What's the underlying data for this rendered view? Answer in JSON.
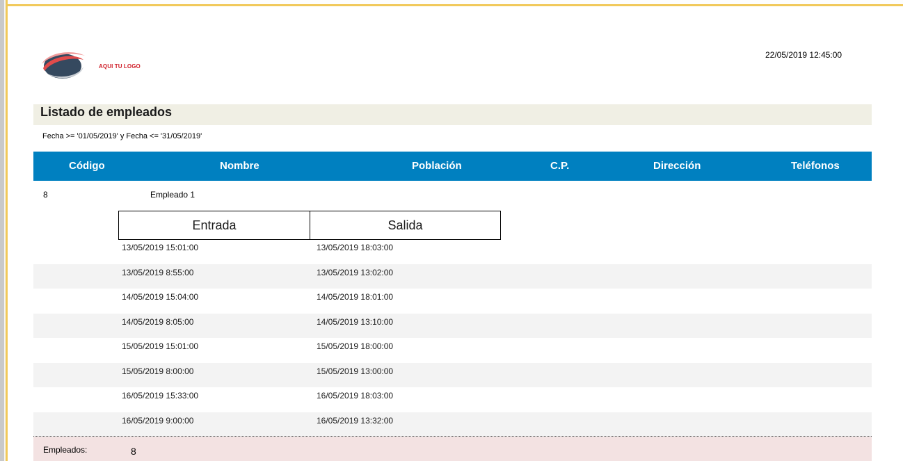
{
  "logo": {
    "text": "AQUI TU LOGO"
  },
  "report": {
    "datetime": "22/05/2019 12:45:00",
    "title": "Listado de empleados",
    "filter": "Fecha >= '01/05/2019' y Fecha <= '31/05/2019'"
  },
  "columns": [
    "Código",
    "Nombre",
    "Población",
    "C.P.",
    "Dirección",
    "Teléfonos"
  ],
  "employee": {
    "code": "8",
    "name": "Empleado 1"
  },
  "subtable": {
    "headers": [
      "Entrada",
      "Salida"
    ],
    "rows": [
      [
        "13/05/2019 15:01:00",
        "13/05/2019 18:03:00"
      ],
      [
        "13/05/2019 8:55:00",
        "13/05/2019 13:02:00"
      ],
      [
        "14/05/2019 15:04:00",
        "14/05/2019 18:01:00"
      ],
      [
        "14/05/2019 8:05:00",
        "14/05/2019 13:10:00"
      ],
      [
        "15/05/2019 15:01:00",
        "15/05/2019 18:00:00"
      ],
      [
        "15/05/2019 8:00:00",
        "15/05/2019 13:00:00"
      ],
      [
        "16/05/2019 15:33:00",
        "16/05/2019 18:03:00"
      ],
      [
        "16/05/2019 9:00:00",
        "16/05/2019 13:32:00"
      ]
    ]
  },
  "footer": {
    "label": "Empleados:",
    "count": "8"
  },
  "colors": {
    "header_bg": "#0080c0",
    "frame": "#f1c95a",
    "title_band": "#f0efe4",
    "footer_bg": "#f3e2e2",
    "logo_red": "#d0202a"
  }
}
